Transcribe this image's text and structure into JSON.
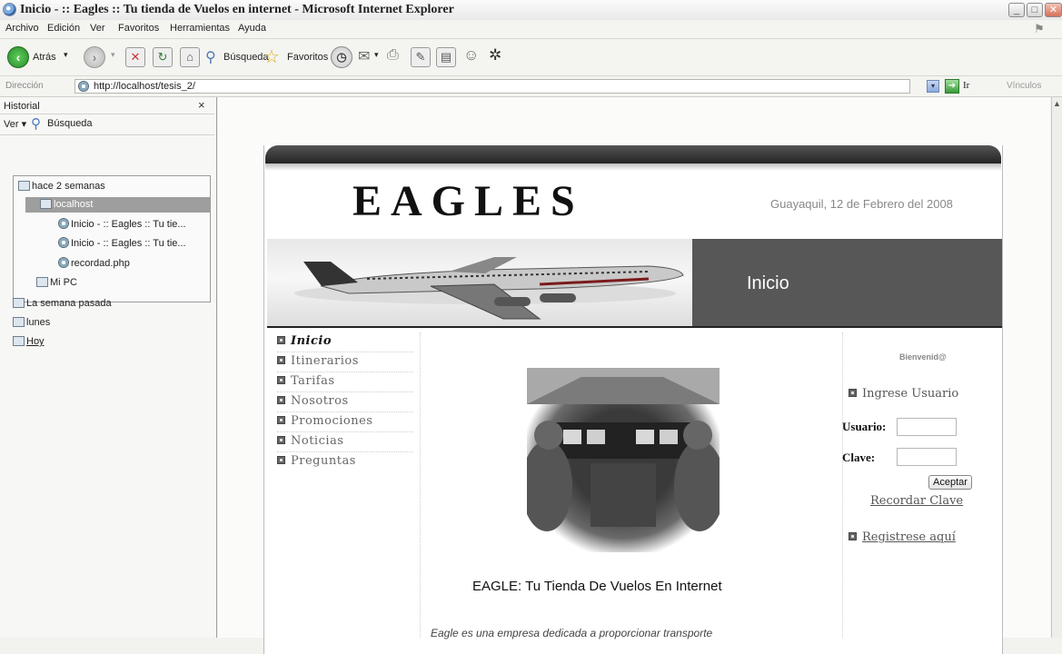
{
  "window": {
    "title": "Inicio - :: Eagles :: Tu tienda de Vuelos en internet - Microsoft Internet Explorer"
  },
  "menu": [
    "Archivo",
    "Edición",
    "Ver",
    "Favoritos",
    "Herramientas",
    "Ayuda"
  ],
  "toolbar": {
    "back_label": "Atrás",
    "search_label": "Búsqueda",
    "favorites_label": "Favoritos"
  },
  "address": {
    "label": "Dirección",
    "url": "http://localhost/tesis_2/",
    "go_label": "Ir",
    "links_label": "Vínculos"
  },
  "history": {
    "title": "Historial",
    "view_label": "Ver",
    "search_label": "Búsqueda",
    "items": [
      "hace 2 semanas",
      "localhost",
      "Inicio - :: Eagles :: Tu tie...",
      "Inicio - :: Eagles :: Tu tie...",
      "recordad.php",
      "Mi PC",
      "La semana pasada",
      "lunes",
      "Hoy"
    ]
  },
  "site": {
    "logo": "EAGLES",
    "date": "Guayaquil, 12 de Febrero del 2008",
    "banner_title": "Inicio",
    "nav": [
      "Inicio",
      "Itinerarios",
      "Tarifas",
      "Nosotros",
      "Promociones",
      "Noticias",
      "Preguntas"
    ],
    "caption": "EAGLE: Tu Tienda De Vuelos En Internet",
    "paragraph": "Eagle es una empresa dedicada a proporcionar transporte",
    "welcome": "Bienvenid@",
    "login_heading": "Ingrese Usuario",
    "user_label": "Usuario:",
    "password_label": "Clave:",
    "accept_label": "Aceptar",
    "remember_label": "Recordar Clave",
    "register_label": "Registrese aquí"
  },
  "colors": {
    "banner_dark": "#575757",
    "header_dark": "#1e1e1e"
  }
}
